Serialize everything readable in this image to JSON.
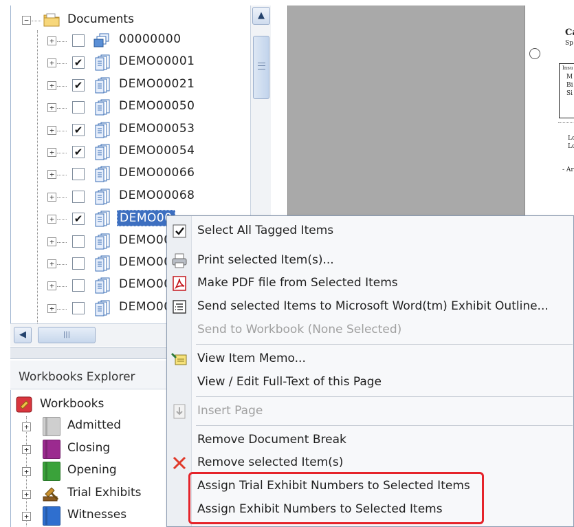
{
  "tree": {
    "root_label": "Documents",
    "rows": [
      {
        "label": "00000000",
        "checked": false,
        "icon": "document-group-icon"
      },
      {
        "label": "DEMO00001",
        "checked": true,
        "icon": "document-stack-icon"
      },
      {
        "label": "DEMO00021",
        "checked": true,
        "icon": "document-stack-icon"
      },
      {
        "label": "DEMO00050",
        "checked": false,
        "icon": "document-stack-icon"
      },
      {
        "label": "DEMO00053",
        "checked": true,
        "icon": "document-stack-icon"
      },
      {
        "label": "DEMO00054",
        "checked": true,
        "icon": "document-stack-icon"
      },
      {
        "label": "DEMO00066",
        "checked": false,
        "icon": "document-stack-icon"
      },
      {
        "label": "DEMO00068",
        "checked": false,
        "icon": "document-stack-icon"
      },
      {
        "label": "DEMO00",
        "checked": true,
        "selected": true,
        "icon": "document-stack-icon"
      },
      {
        "label": "DEMO00",
        "checked": false,
        "icon": "document-stack-icon"
      },
      {
        "label": "DEMO00",
        "checked": false,
        "icon": "document-stack-icon"
      },
      {
        "label": "DEMO00",
        "checked": false,
        "icon": "document-stack-icon"
      },
      {
        "label": "DEMO00",
        "checked": false,
        "icon": "document-stack-icon"
      }
    ],
    "check_glyph": "✔",
    "expander_glyph": "+",
    "root_expander_glyph": "−"
  },
  "scrollbars": {
    "up_glyph": "▲",
    "left_glyph": "◀",
    "grip_glyph": "|||"
  },
  "workbooks_explorer": {
    "title": "Workbooks Explorer",
    "root_label": "Workbooks",
    "items": [
      {
        "label": "Admitted",
        "color": "#cfcfcf"
      },
      {
        "label": "Closing",
        "color": "#9b2a8f"
      },
      {
        "label": "Opening",
        "color": "#3aa23a"
      },
      {
        "label": "Trial Exhibits",
        "color": "#c9902e",
        "icon": "gavel-icon"
      },
      {
        "label": "Witnesses",
        "color": "#2f6fcf"
      }
    ]
  },
  "preview": {
    "page_text": [
      "Ca",
      "Sp",
      "Insu",
      "M",
      "Bi",
      "Si",
      "Lo",
      "Lo",
      "- Ar"
    ]
  },
  "context_menu": {
    "items": [
      {
        "label": "Select All Tagged Items",
        "icon": "checkmark-icon",
        "enabled": true
      },
      {
        "label": "Print selected Item(s)...",
        "icon": "printer-icon",
        "enabled": true
      },
      {
        "label": "Make PDF file from Selected Items",
        "icon": "pdf-icon",
        "enabled": true
      },
      {
        "label": "Send selected Items to Microsoft Word(tm) Exhibit Outline...",
        "icon": "outline-icon",
        "enabled": true
      },
      {
        "label": "Send to Workbook (None Selected)",
        "icon": "",
        "enabled": false
      },
      {
        "label": "View Item Memo...",
        "icon": "memo-icon",
        "enabled": true
      },
      {
        "label": "View / Edit Full-Text of this Page",
        "icon": "",
        "enabled": true
      },
      {
        "label": "Insert Page",
        "icon": "insert-page-icon",
        "enabled": false
      },
      {
        "label": "Remove Document Break",
        "icon": "",
        "enabled": true
      },
      {
        "label": "Remove selected Item(s)",
        "icon": "red-x-icon",
        "enabled": true
      },
      {
        "label": "Assign Trial Exhibit Numbers to Selected Items",
        "icon": "",
        "enabled": true
      },
      {
        "label": "Assign Exhibit Numbers to Selected Items",
        "icon": "",
        "enabled": true
      }
    ],
    "highlight_color": "#e5232a"
  }
}
